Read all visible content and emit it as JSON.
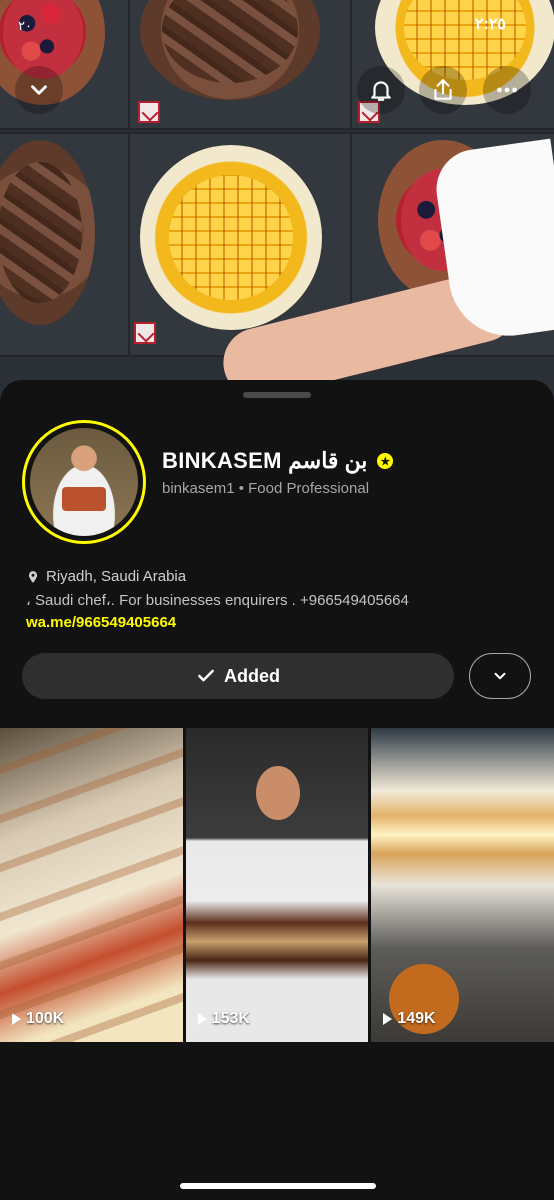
{
  "status_bar": {
    "time": "٢:٢٥",
    "carrier_text": "٢٠"
  },
  "top_actions": {
    "collapse_icon": "chevron-down-icon",
    "notify_icon": "bell-icon",
    "share_icon": "share-icon",
    "more_icon": "ellipsis-icon"
  },
  "profile": {
    "display_name": "BINKASEM بن قاسم",
    "username_category": "binkasem1 • Food Professional",
    "location": "Riyadh, Saudi Arabia",
    "bio": "، Saudi chef،. For businesses enquirers . +966549405664",
    "link": "wa.me/966549405664",
    "verified_color": "#fffc00"
  },
  "actions": {
    "added_label": "Added",
    "more_icon": "chevron-down-icon"
  },
  "stories": [
    {
      "views": "100K"
    },
    {
      "views": "153K"
    },
    {
      "views": "149K"
    }
  ]
}
